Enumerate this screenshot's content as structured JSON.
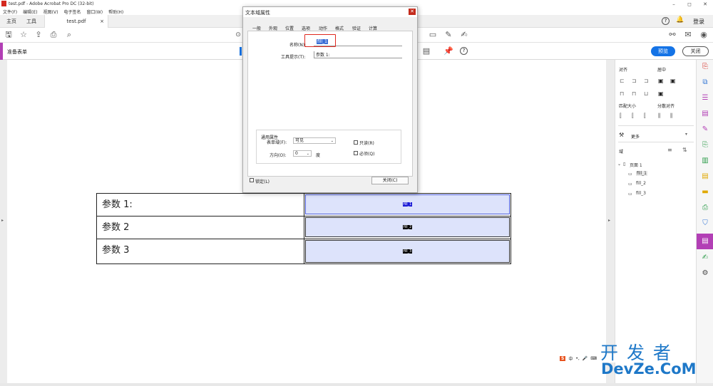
{
  "window": {
    "title": "test.pdf - Adobe Acrobat Pro DC (32-bit)"
  },
  "menu": [
    "文件(F)",
    "编辑(E)",
    "视图(V)",
    "电子签名",
    "窗口(W)",
    "帮助(H)"
  ],
  "tabs": {
    "home": "主页",
    "tools": "工具",
    "doc": "test.pdf"
  },
  "header": {
    "login": "登录"
  },
  "form_bar": {
    "title": "准备表单",
    "preview": "预览",
    "close": "关闭"
  },
  "table": {
    "rows": [
      {
        "label": "参数 1:",
        "field": "fill_1"
      },
      {
        "label": "参数 2",
        "field": "fill_2"
      },
      {
        "label": "参数 3",
        "field": "fill_3"
      }
    ]
  },
  "dialog": {
    "title": "文本域属性",
    "tabs": [
      "一般",
      "外观",
      "位置",
      "选项",
      "动作",
      "格式",
      "验证",
      "计算"
    ],
    "name_label": "名称(N):",
    "name_value": "fill_1",
    "tooltip_label": "工具提示(T):",
    "tooltip_value": "参数 1:",
    "common_group": "通用属性",
    "form_field_label": "表单域(F):",
    "form_field_value": "可见",
    "readonly_label": "只读(R)",
    "orientation_label": "方向(O):",
    "orientation_value": "0",
    "degree": "度",
    "required_label": "必须(Q)",
    "locked_label": "锁定(L)",
    "close_button": "关闭(C)"
  },
  "right_panel": {
    "align": "对齐",
    "center": "居中",
    "match_size": "匹配大小",
    "distribute": "分散对齐",
    "more": "更多",
    "fields": "域",
    "page": "页面 1",
    "items": [
      "fill_1",
      "fill_2",
      "fill_3"
    ]
  },
  "watermark": {
    "line1": "开 发 者",
    "line2": "DevZe.CoM"
  },
  "ime": "中",
  "accent_colors": {
    "primary": "#1473e6",
    "form_accent": "#b23fb5"
  }
}
